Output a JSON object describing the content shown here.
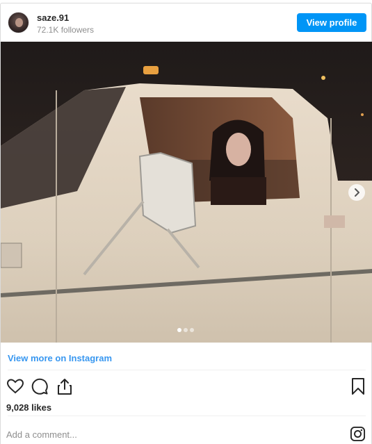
{
  "profile": {
    "username": "saze.91",
    "followers": "72.1K followers",
    "view_profile_label": "View profile",
    "avatar_icon": "avatar-photo"
  },
  "photo": {
    "description_icon": "photo-carousel",
    "carousel_dots": 3,
    "active_dot": 1,
    "next_icon": "chevron-right-icon"
  },
  "links": {
    "view_more": "View more on Instagram"
  },
  "actions": {
    "like_icon": "heart-icon",
    "comment_icon": "comment-icon",
    "share_icon": "share-icon",
    "save_icon": "bookmark-icon"
  },
  "stats": {
    "likes": "9,028 likes"
  },
  "comment_box": {
    "placeholder": "Add a comment...",
    "logo_icon": "instagram-icon"
  },
  "colors": {
    "accent": "#0095f6",
    "link": "#3897f0",
    "text": "#262626",
    "muted": "#8e8e8e"
  }
}
